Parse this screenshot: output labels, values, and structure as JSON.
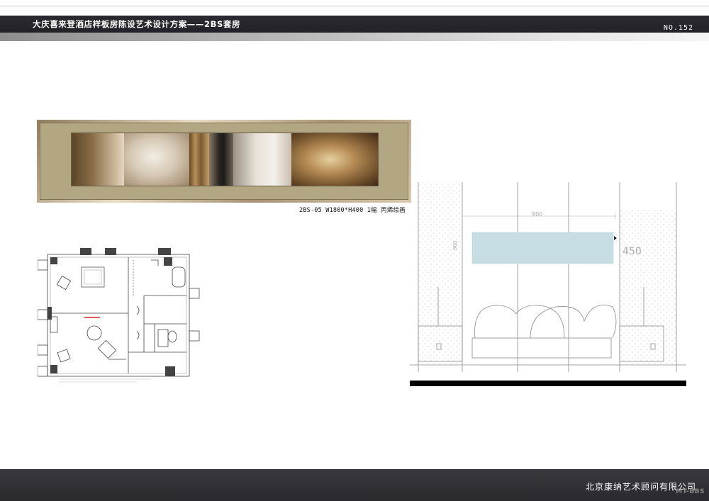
{
  "header": {
    "title": "大庆喜来登酒店样板房陈设艺术设计方案——2BS套房",
    "page_number": "NO.152"
  },
  "painting": {
    "caption": "2BS-05 W1800*H400 1幅 丙烯绘画"
  },
  "floorplan": {
    "label": "floor plan"
  },
  "elevation": {
    "dim_width": "900",
    "dim_height": "450",
    "dim_side": "600"
  },
  "footer": {
    "company": "北京康纳艺术顾问有限公司",
    "watermark": "MT-BBS"
  },
  "colors": {
    "header_bg": "#2b2a30",
    "artwork_placeholder": "#c5dde3",
    "highlight_line": "#e02020"
  }
}
